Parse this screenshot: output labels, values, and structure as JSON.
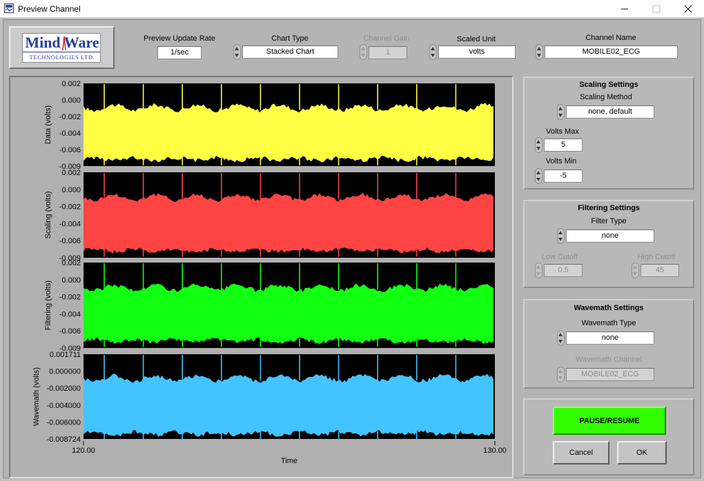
{
  "window": {
    "title": "Preview Channel"
  },
  "logo": {
    "top": "Mind Ware",
    "bottom": "TECHNOLOGIES LTD."
  },
  "controls": {
    "preview_rate": {
      "label": "Preview Update Rate",
      "value": "1/sec"
    },
    "chart_type": {
      "label": "Chart Type",
      "value": "Stacked Chart"
    },
    "channel_gain": {
      "label": "Channel Gain",
      "value": "1"
    },
    "scaled_unit": {
      "label": "Scaled Unit",
      "value": "volts"
    },
    "channel_name": {
      "label": "Channel Name",
      "value": "MOBILE02_ECG"
    }
  },
  "scaling": {
    "title": "Scaling Settings",
    "method_label": "Scaling Method",
    "method_value": "none, default",
    "vmax_label": "Volts Max",
    "vmax_value": "5",
    "vmin_label": "Volts Min",
    "vmin_value": "-5"
  },
  "filtering": {
    "title": "Filtering Settings",
    "type_label": "Filter Type",
    "type_value": "none",
    "low_label": "Low Cutoff",
    "low_value": "0.5",
    "high_label": "High Cutoff",
    "high_value": "45"
  },
  "wavemath": {
    "title": "Wavemath Settings",
    "type_label": "Wavemath Type",
    "type_value": "none",
    "channel_label": "Wavemath Channel",
    "channel_value": "MOBILE02_ECG"
  },
  "buttons": {
    "pause": "PAUSE/RESUME",
    "cancel": "Cancel",
    "ok": "OK"
  },
  "colors": {
    "data": "#ffff44",
    "scaling": "#ff4444",
    "filtering": "#11ff11",
    "wavemath": "#44c4ff",
    "plot_bg": "#000000",
    "pause": "#33ff00"
  },
  "chart_data": [
    {
      "type": "line",
      "ylabel": "Data (volts)",
      "color": "#ffff44",
      "ylim": [
        -0.009,
        0.002
      ],
      "yticks": [
        "0.002",
        "0.000",
        "-0.002",
        "-0.004",
        "-0.006",
        "-0.009"
      ],
      "x": [
        120,
        130
      ],
      "band_upper": -0.0015,
      "band_lower": -0.0078,
      "peaks": 10
    },
    {
      "type": "line",
      "ylabel": "Scaling (volts)",
      "color": "#ff4444",
      "ylim": [
        -0.009,
        0.002
      ],
      "yticks": [
        "0.002",
        "0.000",
        "-0.002",
        "-0.004",
        "-0.006",
        "-0.009"
      ],
      "x": [
        120,
        130
      ],
      "band_upper": -0.0015,
      "band_lower": -0.0078,
      "peaks": 10
    },
    {
      "type": "line",
      "ylabel": "Filtering (volts)",
      "color": "#11ff11",
      "ylim": [
        -0.009,
        0.002
      ],
      "yticks": [
        "0.002",
        "0.000",
        "-0.002",
        "-0.004",
        "-0.006",
        "-0.009"
      ],
      "x": [
        120,
        130
      ],
      "band_upper": -0.0015,
      "band_lower": -0.0078,
      "peaks": 10
    },
    {
      "type": "line",
      "ylabel": "Wavemath (volts)",
      "color": "#44c4ff",
      "ylim": [
        -0.008724,
        0.001711
      ],
      "yticks": [
        "0.001711",
        "0.000000",
        "-0.002000",
        "-0.004000",
        "-0.006000",
        "-0.008724"
      ],
      "x": [
        120,
        130
      ],
      "band_upper": -0.0015,
      "band_lower": -0.0078,
      "peaks": 10
    }
  ],
  "x_axis": {
    "label": "Time",
    "min_label": "120.00",
    "max_label": "130.00"
  }
}
